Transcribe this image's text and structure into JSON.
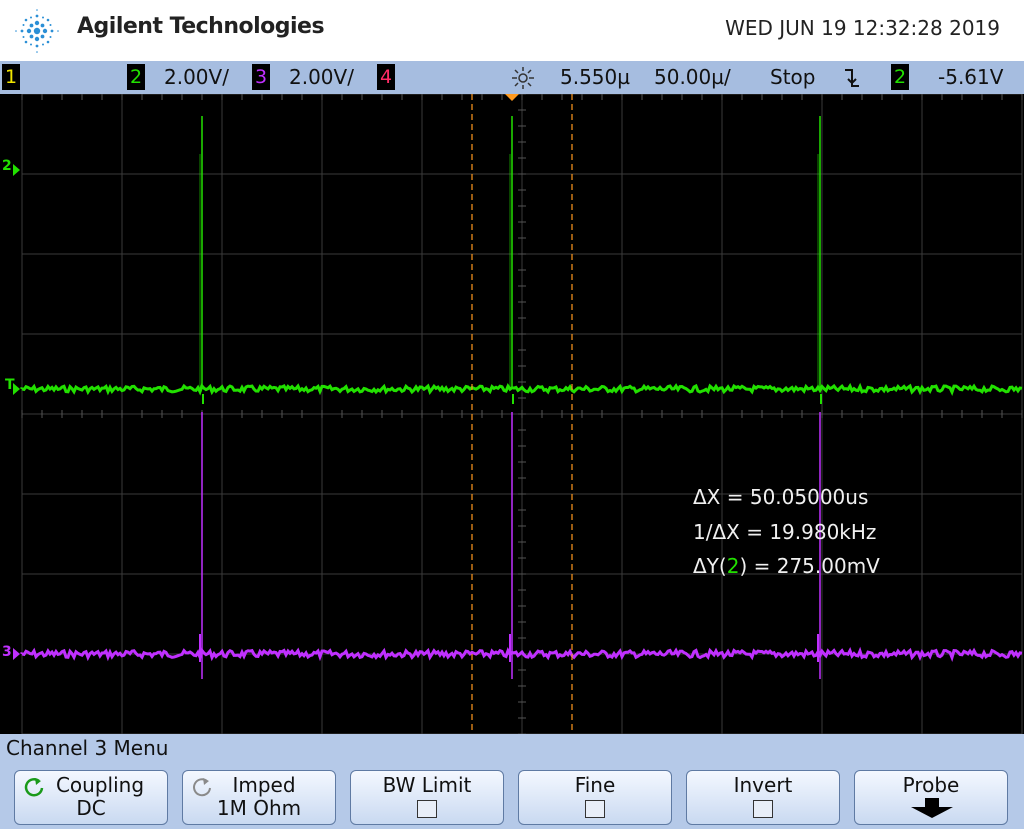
{
  "header": {
    "brand": "Agilent Technologies",
    "datetime": "WED JUN 19 12:32:28 2019",
    "logo_icon": "agilent-spark-icon"
  },
  "statusbar": {
    "ch1": "1",
    "ch2": "2",
    "ch2_scale": "2.00V/",
    "ch3": "3",
    "ch3_scale": "2.00V/",
    "ch4": "4",
    "delay": "5.550µ",
    "timebase": "50.00µ/",
    "run_state": "Stop",
    "trigger_slope_icon": "falling-edge-icon",
    "trigger_source": "2",
    "trigger_level": "-5.61V",
    "colors": {
      "ch1": "#f2e600",
      "ch2": "#22e000",
      "ch3": "#c030ff",
      "ch4": "#ff2b66"
    }
  },
  "screen": {
    "markers": {
      "ch2": "2",
      "trigger": "T",
      "ch3": "3"
    },
    "measurements": {
      "dx": "ΔX = 50.05000us",
      "inv_dx": "1/ΔX = 19.980kHz",
      "dy_prefix": "ΔY(",
      "dy_channel": "2",
      "dy_suffix": ") = 275.00mV"
    }
  },
  "menu": {
    "title": "Channel 3  Menu",
    "softkeys": [
      {
        "top": "Coupling",
        "bottom": "DC",
        "icon": "rotate-knob-icon"
      },
      {
        "top": "Imped",
        "bottom": "1M Ohm",
        "icon": "rotate-knob-icon"
      },
      {
        "top": "BW Limit",
        "checkbox": false
      },
      {
        "top": "Fine",
        "checkbox": false
      },
      {
        "top": "Invert",
        "checkbox": false
      },
      {
        "top": "Probe",
        "icon": "down-arrow-icon"
      }
    ]
  }
}
